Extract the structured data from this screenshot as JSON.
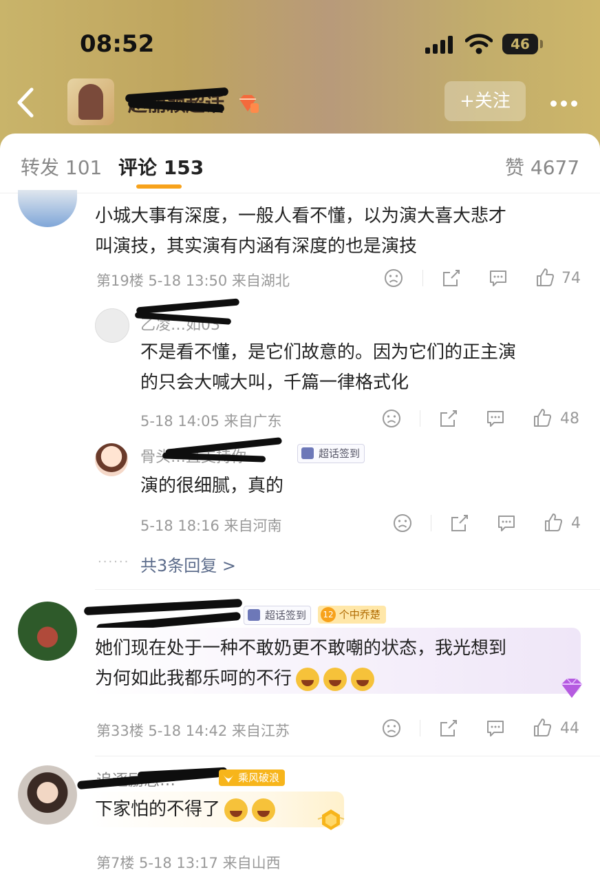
{
  "status": {
    "time": "08:52",
    "battery": "46"
  },
  "header": {
    "account_name": "赵丽颖超话",
    "follow_label": "+关注"
  },
  "tabs": {
    "repost": "转发 101",
    "comments": "评论 153",
    "likes": "赞 4677"
  },
  "comments": [
    {
      "text_line1": "小城大事有深度，一般人看不懂，以为演大喜大悲才",
      "text_line2": "叫演技，其实演有内涵有深度的也是演技",
      "meta": "第19楼  5-18 13:50  来自湖北",
      "likes": "74",
      "replies": [
        {
          "name": "乙凌…如03",
          "text_line1": "不是看不懂，是它们故意的。因为它们的正主演",
          "text_line2": "的只会大喊大叫，千篇一律格式化",
          "meta": "5-18 14:05  来自广东",
          "likes": "48"
        },
        {
          "name": "骨头…直支持你",
          "badge": "超话签到",
          "text": "演的很细腻，真的",
          "meta": "5-18 18:16  来自河南",
          "likes": "4"
        }
      ],
      "more_replies": "共3条回复 >"
    },
    {
      "badge": "超话签到",
      "level_badge": "12",
      "level_text": "个中乔楚",
      "text_line1": "她们现在处于一种不敢奶更不敢嘲的状态，我光想到",
      "text_line2": "为何如此我都乐呵的不行",
      "meta": "第33楼  5-18 14:42  来自江苏",
      "likes": "44"
    },
    {
      "name": "追逐励志…",
      "level_text": "乘风破浪",
      "text": "下家怕的不得了",
      "meta": "第7楼  5-18 13:17  来自山西"
    }
  ],
  "colors": {
    "accent": "#f7a21b",
    "header_gold": "#c9b46a",
    "link": "#5b6b8a"
  }
}
